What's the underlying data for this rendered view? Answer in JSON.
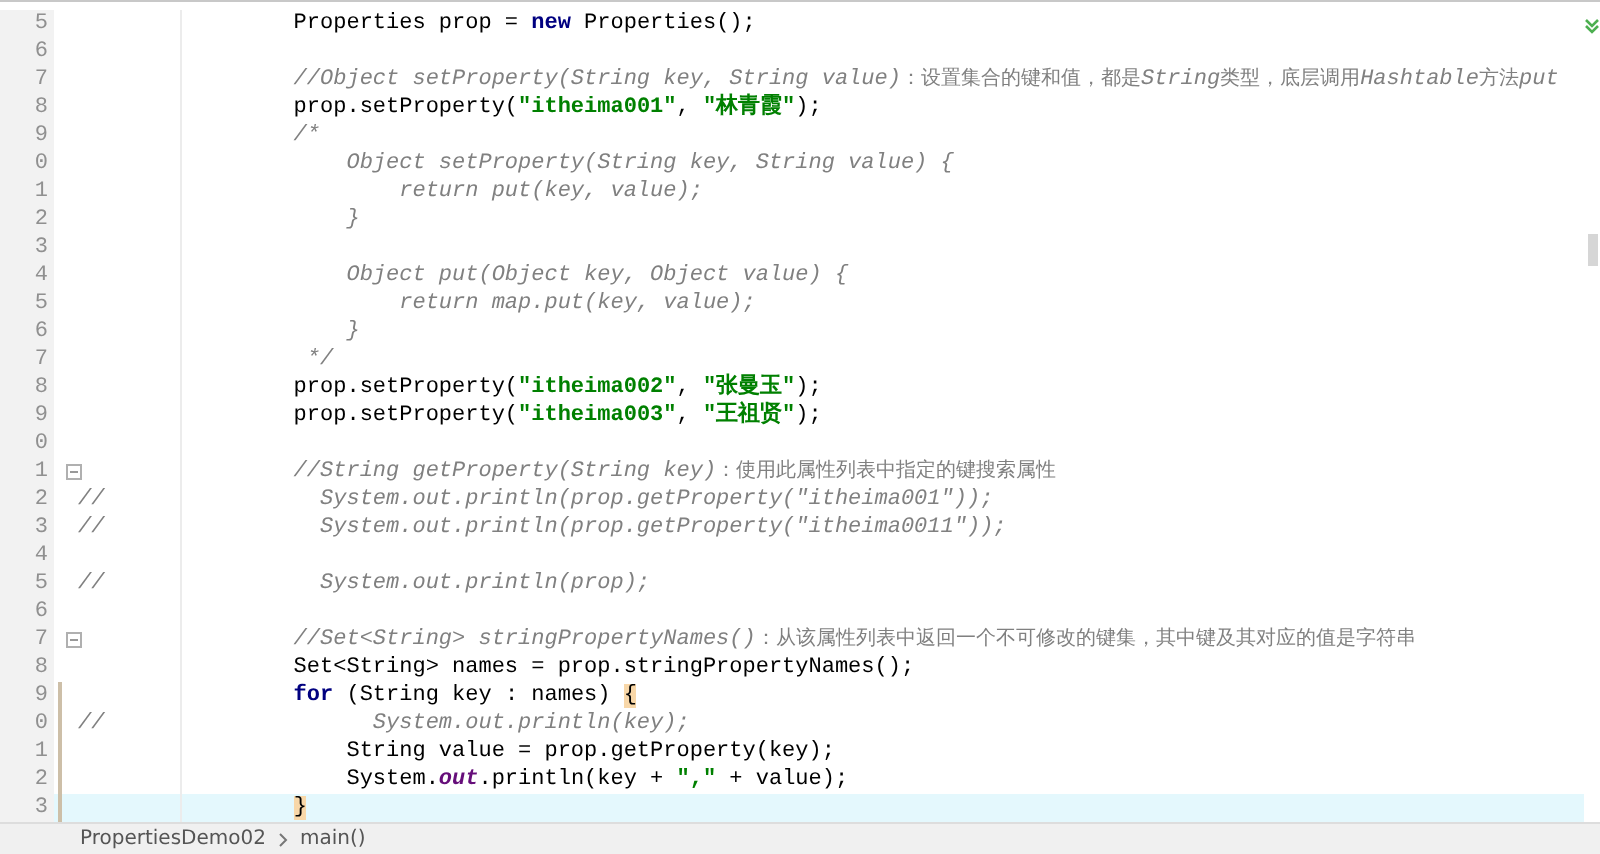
{
  "editor": {
    "lines": [
      {
        "number": "5",
        "fold": false,
        "changed": false,
        "current": false,
        "tokens": [
          {
            "kind": "plain",
            "text": "        Properties prop = "
          },
          {
            "kind": "keyword",
            "text": "new"
          },
          {
            "kind": "plain",
            "text": " Properties();"
          }
        ]
      },
      {
        "number": "6",
        "fold": false,
        "changed": false,
        "current": false
      },
      {
        "number": "7",
        "fold": false,
        "changed": false,
        "current": false,
        "tokens": [
          {
            "kind": "comment",
            "text": "        //Object setProperty(String key, String value)"
          },
          {
            "kind": "comment_cjk",
            "text": "：设置集合的键和值，都是"
          },
          {
            "kind": "comment",
            "text": "String"
          },
          {
            "kind": "comment_cjk",
            "text": "类型，底层调用"
          },
          {
            "kind": "comment",
            "text": "Hashtable"
          },
          {
            "kind": "comment_cjk",
            "text": "方法"
          },
          {
            "kind": "comment",
            "text": "put"
          }
        ]
      },
      {
        "number": "8",
        "fold": false,
        "changed": false,
        "current": false,
        "tokens": [
          {
            "kind": "plain",
            "text": "        prop.setProperty("
          },
          {
            "kind": "string",
            "text": "\"itheima001\""
          },
          {
            "kind": "plain",
            "text": ", "
          },
          {
            "kind": "string",
            "text": "\"林青霞\""
          },
          {
            "kind": "plain",
            "text": ");"
          }
        ]
      },
      {
        "number": "9",
        "fold": false,
        "changed": false,
        "current": false,
        "tokens": [
          {
            "kind": "comment",
            "text": "        /*"
          }
        ]
      },
      {
        "number": "0",
        "fold": false,
        "changed": false,
        "current": false,
        "tokens": [
          {
            "kind": "comment",
            "text": "            Object setProperty(String key, String value) {"
          }
        ]
      },
      {
        "number": "1",
        "fold": false,
        "changed": false,
        "current": false,
        "tokens": [
          {
            "kind": "comment",
            "text": "                return put(key, value);"
          }
        ]
      },
      {
        "number": "2",
        "fold": false,
        "changed": false,
        "current": false,
        "tokens": [
          {
            "kind": "comment",
            "text": "            }"
          }
        ]
      },
      {
        "number": "3",
        "fold": false,
        "changed": false,
        "current": false
      },
      {
        "number": "4",
        "fold": false,
        "changed": false,
        "current": false,
        "tokens": [
          {
            "kind": "comment",
            "text": "            Object put(Object key, Object value) {"
          }
        ]
      },
      {
        "number": "5",
        "fold": false,
        "changed": false,
        "current": false,
        "tokens": [
          {
            "kind": "comment",
            "text": "                return map.put(key, value);"
          }
        ]
      },
      {
        "number": "6",
        "fold": false,
        "changed": false,
        "current": false,
        "tokens": [
          {
            "kind": "comment",
            "text": "            }"
          }
        ]
      },
      {
        "number": "7",
        "fold": false,
        "changed": false,
        "current": false,
        "tokens": [
          {
            "kind": "comment",
            "text": "         */"
          }
        ]
      },
      {
        "number": "8",
        "fold": false,
        "changed": false,
        "current": false,
        "tokens": [
          {
            "kind": "plain",
            "text": "        prop.setProperty("
          },
          {
            "kind": "string",
            "text": "\"itheima002\""
          },
          {
            "kind": "plain",
            "text": ", "
          },
          {
            "kind": "string",
            "text": "\"张曼玉\""
          },
          {
            "kind": "plain",
            "text": ");"
          }
        ]
      },
      {
        "number": "9",
        "fold": false,
        "changed": false,
        "current": false,
        "tokens": [
          {
            "kind": "plain",
            "text": "        prop.setProperty("
          },
          {
            "kind": "string",
            "text": "\"itheima003\""
          },
          {
            "kind": "plain",
            "text": ", "
          },
          {
            "kind": "string",
            "text": "\"王祖贤\""
          },
          {
            "kind": "plain",
            "text": ");"
          }
        ]
      },
      {
        "number": "0",
        "fold": false,
        "changed": false,
        "current": false
      },
      {
        "number": "1",
        "fold": true,
        "changed": false,
        "current": false,
        "tokens": [
          {
            "kind": "comment",
            "text": "        //String getProperty(String key)"
          },
          {
            "kind": "comment_cjk",
            "text": "：使用此属性列表中指定的键搜索属性"
          }
        ]
      },
      {
        "number": "2",
        "fold": false,
        "changed": false,
        "current": false,
        "gutter_mark": "//",
        "tokens": [
          {
            "kind": "comment",
            "text": "          System.out.println(prop.getProperty(\"itheima001\"));"
          }
        ]
      },
      {
        "number": "3",
        "fold": false,
        "changed": false,
        "current": false,
        "gutter_mark": "//",
        "tokens": [
          {
            "kind": "comment",
            "text": "          System.out.println(prop.getProperty(\"itheima0011\"));"
          }
        ]
      },
      {
        "number": "4",
        "fold": false,
        "changed": false,
        "current": false
      },
      {
        "number": "5",
        "fold": false,
        "changed": false,
        "current": false,
        "gutter_mark": "//",
        "tokens": [
          {
            "kind": "comment",
            "text": "          System.out.println(prop);"
          }
        ]
      },
      {
        "number": "6",
        "fold": false,
        "changed": false,
        "current": false
      },
      {
        "number": "7",
        "fold": true,
        "changed": false,
        "current": false,
        "tokens": [
          {
            "kind": "comment",
            "text": "        //Set<String> stringPropertyNames()"
          },
          {
            "kind": "comment_cjk",
            "text": "：从该属性列表中返回一个不可修改的键集，其中键及其对应的值是字符串"
          }
        ]
      },
      {
        "number": "8",
        "fold": false,
        "changed": false,
        "current": false,
        "tokens": [
          {
            "kind": "plain",
            "text": "        Set<String> names = prop.stringPropertyNames();"
          }
        ]
      },
      {
        "number": "9",
        "fold": false,
        "changed": true,
        "current": false,
        "tokens": [
          {
            "kind": "keyword",
            "text": "        for"
          },
          {
            "kind": "plain",
            "text": " (String key : names) "
          },
          {
            "kind": "brace_match",
            "text": "{"
          }
        ]
      },
      {
        "number": "0",
        "fold": false,
        "changed": true,
        "current": false,
        "gutter_mark": "//",
        "tokens": [
          {
            "kind": "comment",
            "text": "              System.out.println(key);"
          }
        ]
      },
      {
        "number": "1",
        "fold": false,
        "changed": true,
        "current": false,
        "tokens": [
          {
            "kind": "plain",
            "text": "            String value = prop.getProperty(key);"
          }
        ]
      },
      {
        "number": "2",
        "fold": false,
        "changed": true,
        "current": false,
        "tokens": [
          {
            "kind": "plain",
            "text": "            System."
          },
          {
            "kind": "field",
            "text": "out"
          },
          {
            "kind": "plain",
            "text": ".println(key + "
          },
          {
            "kind": "string",
            "text": "\",\""
          },
          {
            "kind": "plain",
            "text": " + value);"
          }
        ]
      },
      {
        "number": "3",
        "fold": false,
        "changed": true,
        "current": true,
        "tokens": [
          {
            "kind": "brace_match",
            "text": "        }"
          }
        ]
      }
    ]
  },
  "breadcrumb": [
    "PropertiesDemo02",
    "main()"
  ]
}
